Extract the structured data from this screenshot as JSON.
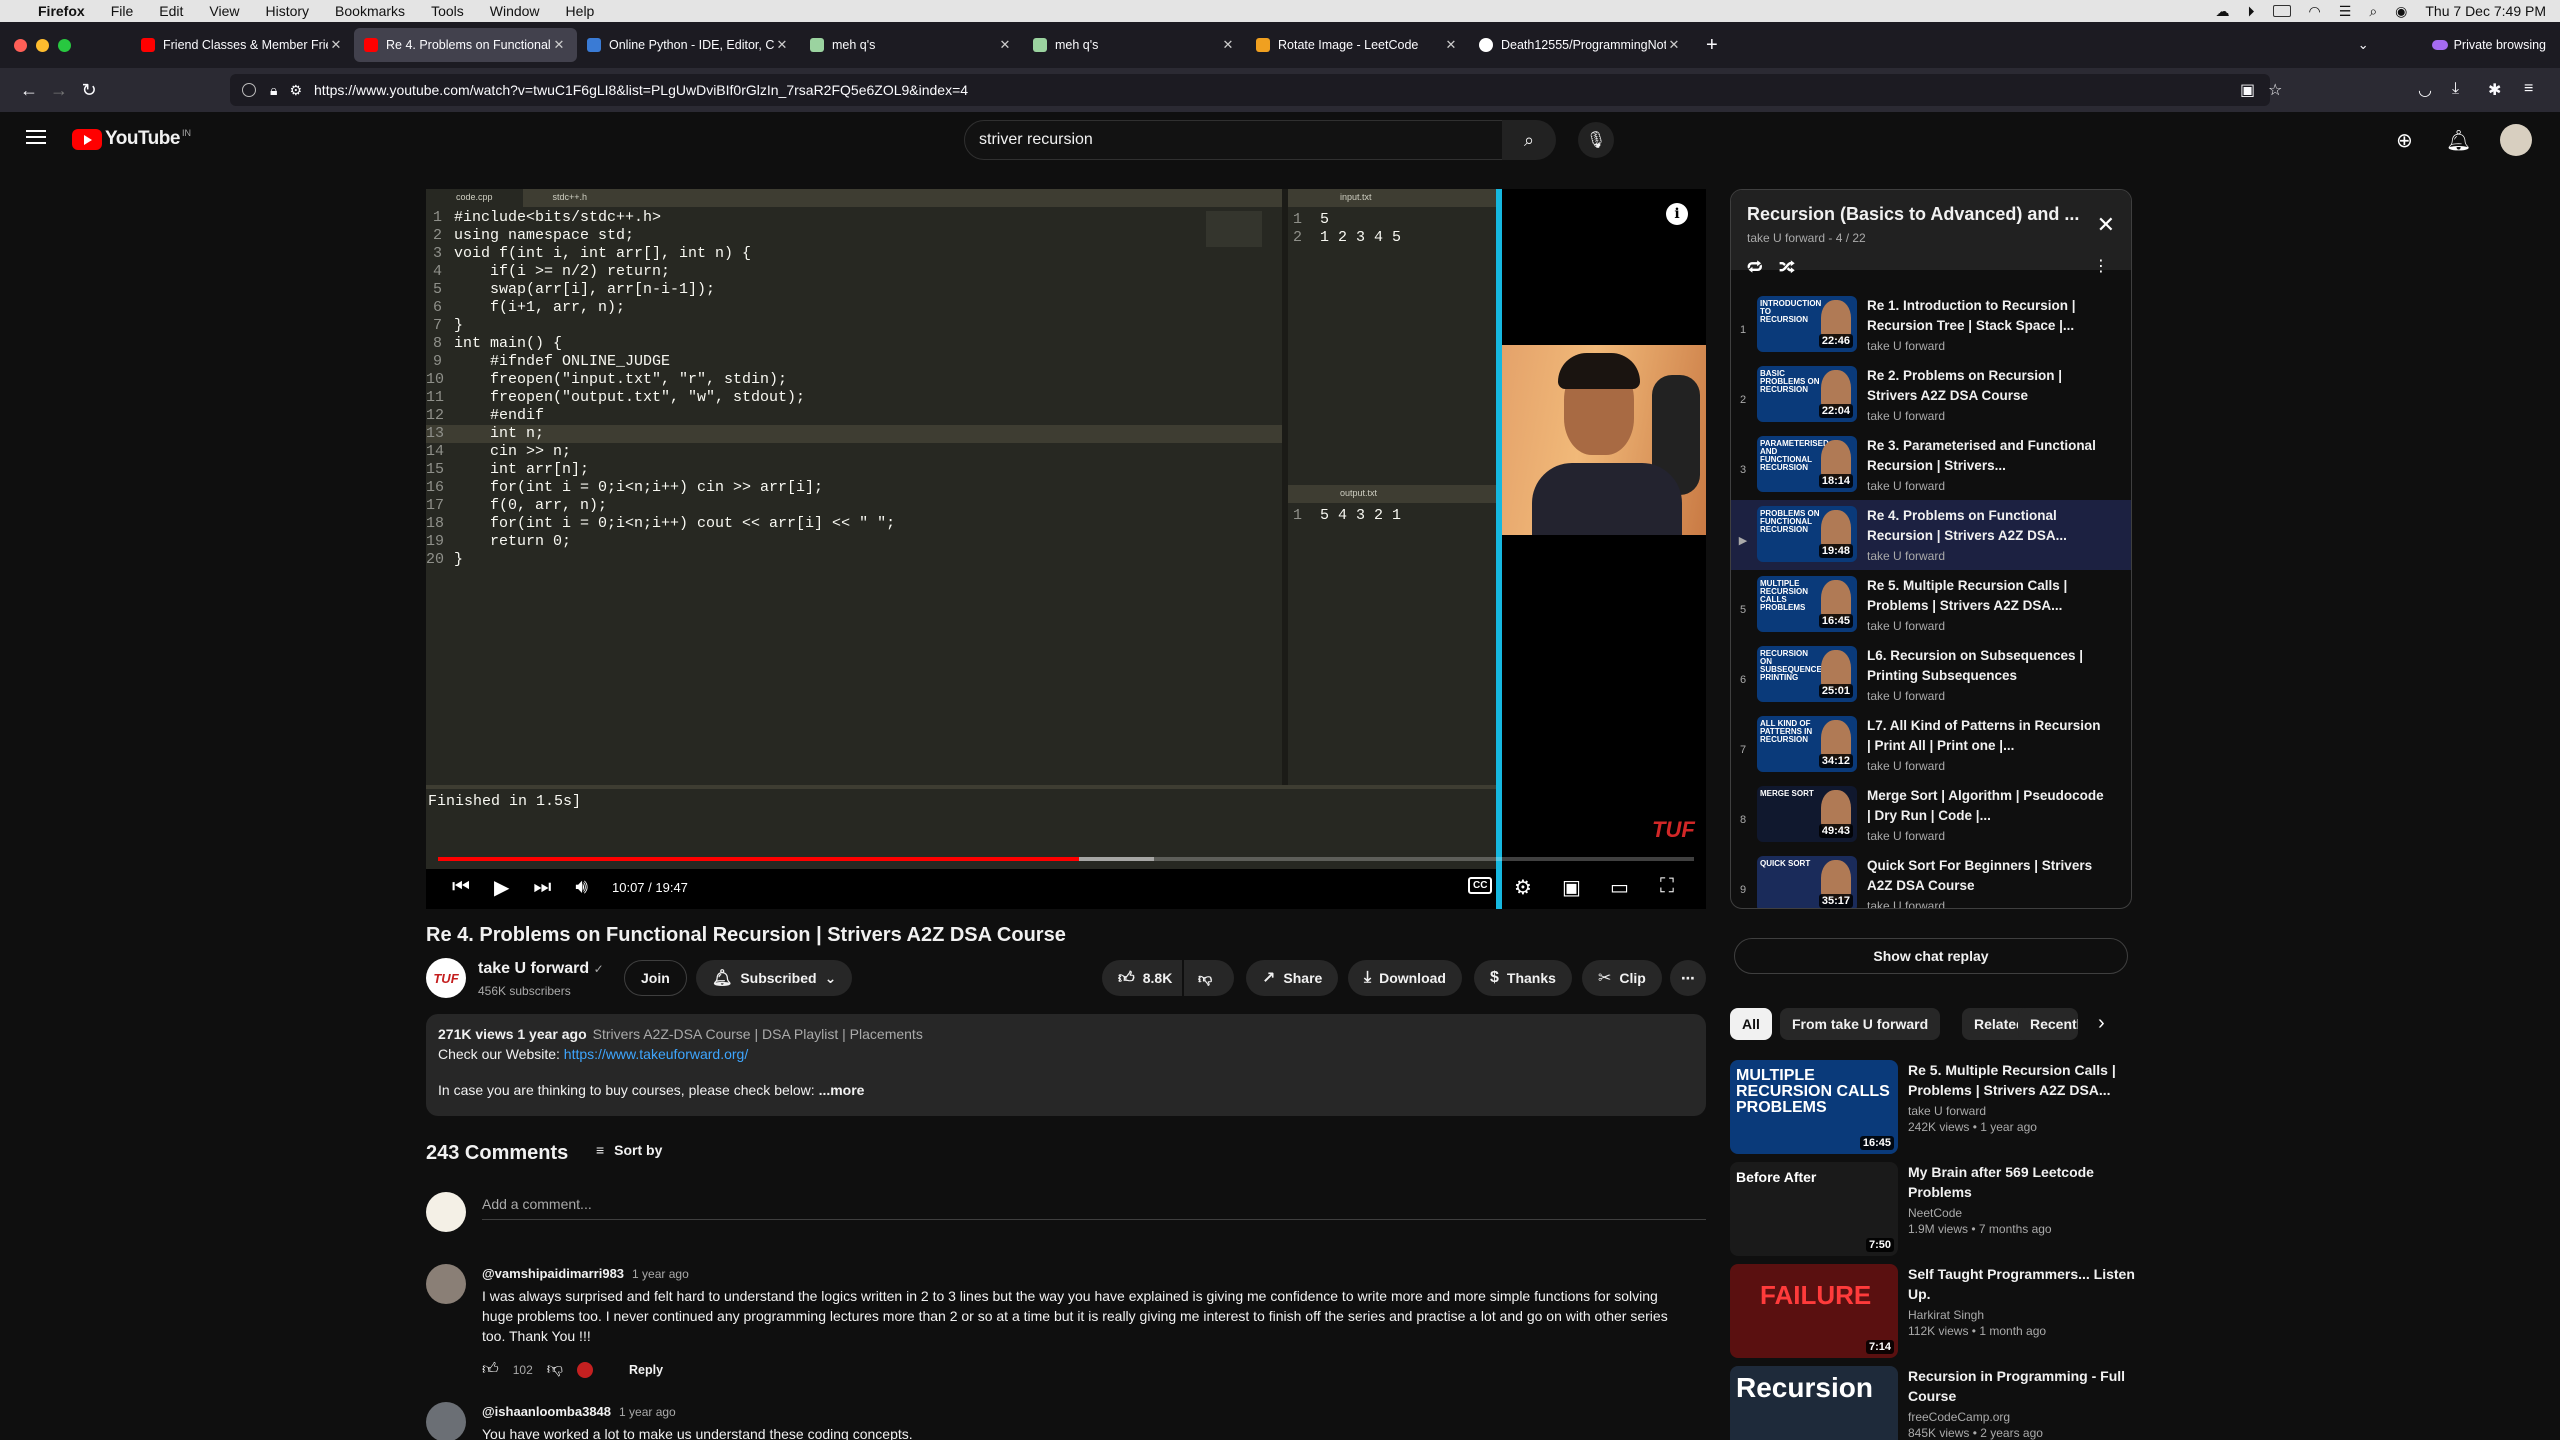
{
  "menubar": {
    "app": "Firefox",
    "items": [
      "File",
      "Edit",
      "View",
      "History",
      "Bookmarks",
      "Tools",
      "Window",
      "Help"
    ],
    "clock": "Thu 7 Dec  7:49 PM"
  },
  "browser": {
    "tabs": [
      {
        "label": "Friend Classes & Member Frien"
      },
      {
        "label": "Re 4. Problems on Functional R"
      },
      {
        "label": "Online Python - IDE, Editor, Co"
      },
      {
        "label": "meh q's"
      },
      {
        "label": "meh q's"
      },
      {
        "label": "Rotate Image - LeetCode"
      },
      {
        "label": "Death12555/ProgrammingNote"
      }
    ],
    "private_label": "Private browsing",
    "url": "https://www.youtube.com/watch?v=twuC1F6gLI8&list=PLgUwDviBIf0rGlzIn_7rsaR2FQ5e6ZOL9&index=4"
  },
  "header": {
    "logo": "YouTube",
    "country": "IN",
    "search_value": "striver recursion"
  },
  "player": {
    "editor_tabs": [
      "code.cpp",
      "stdc++.h"
    ],
    "code_lines": [
      "#include<bits/stdc++.h>",
      "using namespace std;",
      "void f(int i, int arr[], int n) {",
      "    if(i >= n/2) return;",
      "    swap(arr[i], arr[n-i-1]);",
      "    f(i+1, arr, n);",
      "}",
      "int main() {",
      "    #ifndef ONLINE_JUDGE",
      "    freopen(\"input.txt\", \"r\", stdin);",
      "    freopen(\"output.txt\", \"w\", stdout);",
      "    #endif",
      "    int n;",
      "    cin >> n;",
      "    int arr[n];",
      "    for(int i = 0;i<n;i++) cin >> arr[i];",
      "    f(0, arr, n);",
      "    for(int i = 0;i<n;i++) cout << arr[i] << \" \";",
      "    return 0;",
      "}"
    ],
    "input_tab": "input.txt",
    "input_lines": [
      "5",
      "1 2 3 4 5"
    ],
    "output_tab": "output.txt",
    "output_lines": [
      "5 4 3 2 1"
    ],
    "console": "Finished in 1.5s]",
    "watermark": "TUF",
    "time": "10:07 / 19:47",
    "progress": 0.51,
    "buffered": 0.57
  },
  "video": {
    "title": "Re 4. Problems on Functional Recursion | Strivers A2Z DSA Course",
    "channel": "take U forward",
    "channel_logo": "TUF",
    "subscribers": "456K subscribers",
    "join": "Join",
    "subscribed": "Subscribed",
    "likes": "8.8K",
    "share": "Share",
    "download": "Download",
    "thanks": "Thanks",
    "clip": "Clip"
  },
  "description": {
    "views": "271K views  1 year ago",
    "tags": "Strivers A2Z-DSA Course | DSA Playlist | Placements",
    "website_label": "Check our Website: ",
    "website_link": "https://www.takeuforward.org/",
    "line3": "In case you are thinking to buy courses, please check below: ",
    "more": "...more"
  },
  "comments": {
    "count": "243 Comments",
    "sort_by": "Sort by",
    "placeholder": "Add a comment...",
    "items": [
      {
        "author": "@vamshipaidimarri983",
        "ago": "1 year ago",
        "text": "I was always surprised and felt hard to understand the logics written in 2 to 3 lines but the way you have explained is giving me confidence to write more and more simple functions for solving huge problems too. I never continued any programming lectures more than 2 or so at a time but it is really giving me interest to finish off the series and practise a lot and go on with other series too. Thank You !!!",
        "likes": "102",
        "reply": "Reply"
      },
      {
        "author": "@ishaanloomba3848",
        "ago": "1 year ago",
        "text": "You have worked a lot to make us understand these coding concepts."
      }
    ]
  },
  "playlist": {
    "title": "Recursion (Basics to Advanced) and ...",
    "sub": "take U forward - 4 / 22",
    "items": [
      {
        "index": "1",
        "title": "Re 1. Introduction to Recursion | Recursion Tree | Stack Space |...",
        "channel": "take U forward",
        "duration": "22:46",
        "thumb_text": "Introduction to Recursion",
        "color": "#0a3a7a"
      },
      {
        "index": "2",
        "title": "Re 2. Problems on Recursion | Strivers A2Z DSA Course",
        "channel": "take U forward",
        "duration": "22:04",
        "thumb_text": "Basic problems on recursion",
        "color": "#0a3a7a"
      },
      {
        "index": "3",
        "title": "Re 3. Parameterised and Functional Recursion | Strivers...",
        "channel": "take U forward",
        "duration": "18:14",
        "thumb_text": "Parameterised and functional recursion",
        "color": "#0a3a7a"
      },
      {
        "index": "▶",
        "title": "Re 4. Problems on Functional Recursion | Strivers A2Z DSA...",
        "channel": "take U forward",
        "duration": "19:48",
        "thumb_text": "Problems on functional recursion",
        "color": "#0a3a7a"
      },
      {
        "index": "5",
        "title": "Re 5. Multiple Recursion Calls | Problems | Strivers A2Z DSA...",
        "channel": "take U forward",
        "duration": "16:45",
        "thumb_text": "Multiple recursion calls problems",
        "color": "#0a3a7a"
      },
      {
        "index": "6",
        "title": "L6. Recursion on Subsequences | Printing Subsequences",
        "channel": "take U forward",
        "duration": "25:01",
        "thumb_text": "Recursion on subsequences printing",
        "color": "#0a3a7a"
      },
      {
        "index": "7",
        "title": "L7. All Kind of Patterns in Recursion | Print All | Print one |...",
        "channel": "take U forward",
        "duration": "34:12",
        "thumb_text": "All kind of patterns in recursion",
        "color": "#0a3a7a"
      },
      {
        "index": "8",
        "title": "Merge Sort | Algorithm | Pseudocode | Dry Run | Code |...",
        "channel": "take U forward",
        "duration": "49:43",
        "thumb_text": "Merge Sort",
        "color": "#10182e"
      },
      {
        "index": "9",
        "title": "Quick Sort For Beginners | Strivers A2Z DSA Course",
        "channel": "take U forward",
        "duration": "35:17",
        "thumb_text": "QUICK SORT",
        "color": "#1a2b5a"
      }
    ]
  },
  "chat_replay": "Show chat replay",
  "chips": [
    "All",
    "From take U forward",
    "Related",
    "Recentl"
  ],
  "recommendations": [
    {
      "title": "Re 5. Multiple Recursion Calls | Problems | Strivers A2Z DSA...",
      "channel": "take U forward",
      "views": "242K views  •  1 year ago",
      "duration": "16:45",
      "thumb_text": "MULTIPLE RECURSION CALLS PROBLEMS",
      "color": "#0a3a7a"
    },
    {
      "title": "My Brain after 569 Leetcode Problems",
      "channel": "NeetCode",
      "views": "1.9M views  •  7 months ago",
      "duration": "7:50",
      "thumb_text": "Before      After",
      "color": "#1a1a1a"
    },
    {
      "title": "Self Taught Programmers... Listen Up.",
      "channel": "Harkirat Singh",
      "views": "112K views  •  1 month ago",
      "duration": "7:14",
      "thumb_text": "FAILURE",
      "color": "#5a1010"
    },
    {
      "title": "Recursion in Programming - Full Course",
      "channel": "freeCodeCamp.org",
      "views": "845K views  •  2 years ago",
      "duration": "",
      "thumb_text": "Recursion",
      "color": "#1e2a3a"
    }
  ]
}
